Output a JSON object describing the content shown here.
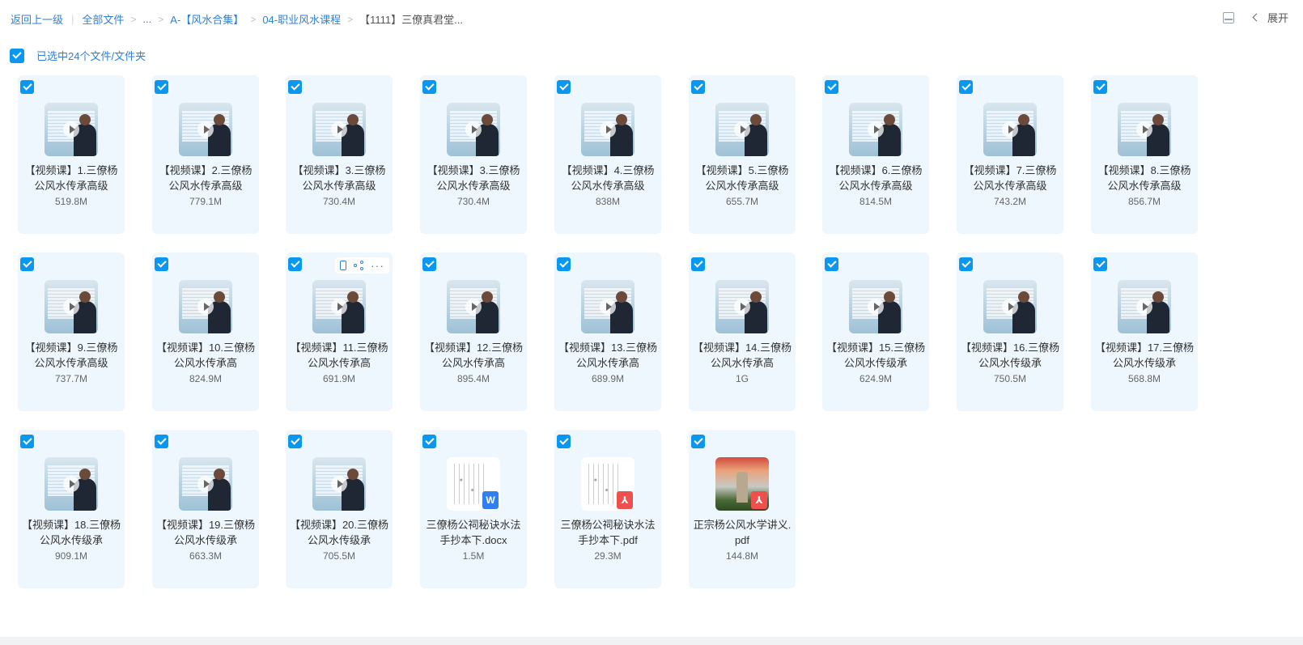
{
  "breadcrumb": {
    "back": "返回上一级",
    "all_files": "全部文件",
    "ellipsis": "...",
    "folder1": "A-【风水合集】",
    "folder2": "04-职业风水课程",
    "current": "【1111】三僚真君堂..."
  },
  "toolbar": {
    "expand_label": "展开"
  },
  "selection": {
    "label": "已选中24个文件/文件夹"
  },
  "files": [
    {
      "name": "【视频课】1.三僚杨公风水传承高级",
      "size": "519.8M",
      "kind": "video"
    },
    {
      "name": "【视频课】2.三僚杨公风水传承高级",
      "size": "779.1M",
      "kind": "video"
    },
    {
      "name": "【视频课】3.三僚杨公风水传承高级",
      "size": "730.4M",
      "kind": "video"
    },
    {
      "name": "【视频课】3.三僚杨公风水传承高级",
      "size": "730.4M",
      "kind": "video"
    },
    {
      "name": "【视频课】4.三僚杨公风水传承高级",
      "size": "838M",
      "kind": "video"
    },
    {
      "name": "【视频课】5.三僚杨公风水传承高级",
      "size": "655.7M",
      "kind": "video"
    },
    {
      "name": "【视频课】6.三僚杨公风水传承高级",
      "size": "814.5M",
      "kind": "video"
    },
    {
      "name": "【视频课】7.三僚杨公风水传承高级",
      "size": "743.2M",
      "kind": "video"
    },
    {
      "name": "【视频课】8.三僚杨公风水传承高级",
      "size": "856.7M",
      "kind": "video"
    },
    {
      "name": "【视频课】9.三僚杨公风水传承高级",
      "size": "737.7M",
      "kind": "video"
    },
    {
      "name": "【视频课】10.三僚杨公风水传承高",
      "size": "824.9M",
      "kind": "video"
    },
    {
      "name": "【视频课】11.三僚杨公风水传承高",
      "size": "691.9M",
      "kind": "video",
      "hover": true
    },
    {
      "name": "【视频课】12.三僚杨公风水传承高",
      "size": "895.4M",
      "kind": "video"
    },
    {
      "name": "【视频课】13.三僚杨公风水传承高",
      "size": "689.9M",
      "kind": "video"
    },
    {
      "name": "【视频课】14.三僚杨公风水传承高",
      "size": "1G",
      "kind": "video"
    },
    {
      "name": "【视频课】15.三僚杨公风水传级承",
      "size": "624.9M",
      "kind": "video"
    },
    {
      "name": "【视频课】16.三僚杨公风水传级承",
      "size": "750.5M",
      "kind": "video"
    },
    {
      "name": "【视频课】17.三僚杨公风水传级承",
      "size": "568.8M",
      "kind": "video"
    },
    {
      "name": "【视频课】18.三僚杨公风水传级承",
      "size": "909.1M",
      "kind": "video"
    },
    {
      "name": "【视频课】19.三僚杨公风水传级承",
      "size": "663.3M",
      "kind": "video"
    },
    {
      "name": "【视频课】20.三僚杨公风水传级承",
      "size": "705.5M",
      "kind": "video"
    },
    {
      "name": "三僚杨公祠秘诀水法手抄本下.docx",
      "size": "1.5M",
      "kind": "docx",
      "badge": "W"
    },
    {
      "name": "三僚杨公祠秘诀水法手抄本下.pdf",
      "size": "29.3M",
      "kind": "pdf",
      "badge": "⅄"
    },
    {
      "name": "正宗杨公风水学讲义.pdf",
      "size": "144.8M",
      "kind": "image-pdf",
      "badge": "⅄"
    }
  ],
  "icons": {
    "check": "check-icon",
    "play": "play-icon",
    "layout": "layout-icon",
    "chevron": "chevron-left-icon"
  },
  "colors": {
    "accent": "#0a97f0",
    "link": "#2f7fd6",
    "card_bg": "#eef7fd"
  }
}
